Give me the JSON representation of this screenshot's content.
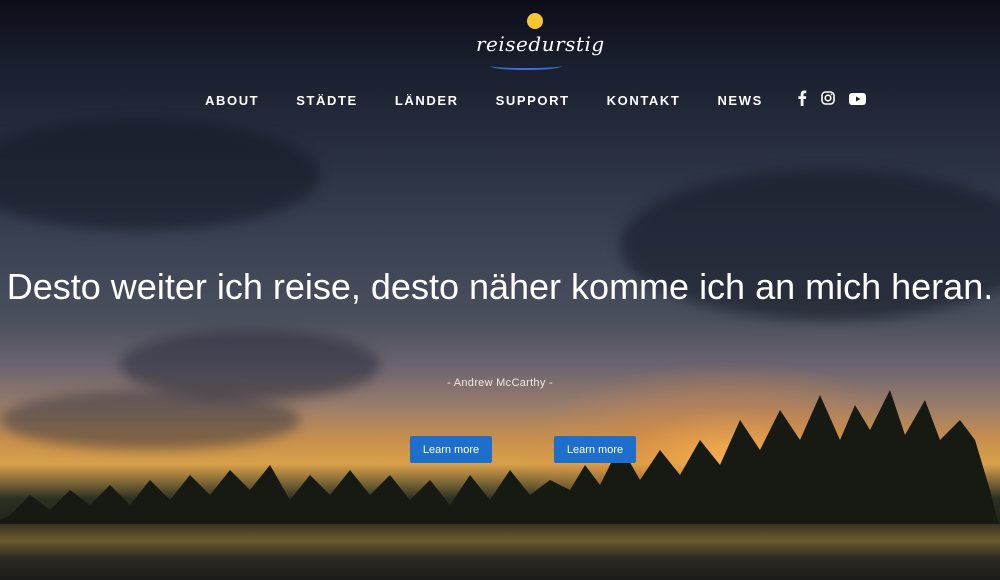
{
  "brand": {
    "name": "reisedurstig",
    "sun_color": "#f6c533",
    "swoosh_color": "#3a6fd0"
  },
  "nav": {
    "items": [
      "ABOUT",
      "STÄDTE",
      "LÄNDER",
      "SUPPORT",
      "KONTAKT",
      "NEWS"
    ]
  },
  "social": {
    "icons": [
      "facebook-icon",
      "instagram-icon",
      "youtube-icon"
    ]
  },
  "hero": {
    "quote": "Desto weiter ich reise, desto näher komme ich an mich heran.",
    "author": "- Andrew McCarthy -"
  },
  "buttons": {
    "primary_label": "Learn more",
    "secondary_label": "Learn more",
    "color": "#1e6ecc"
  }
}
